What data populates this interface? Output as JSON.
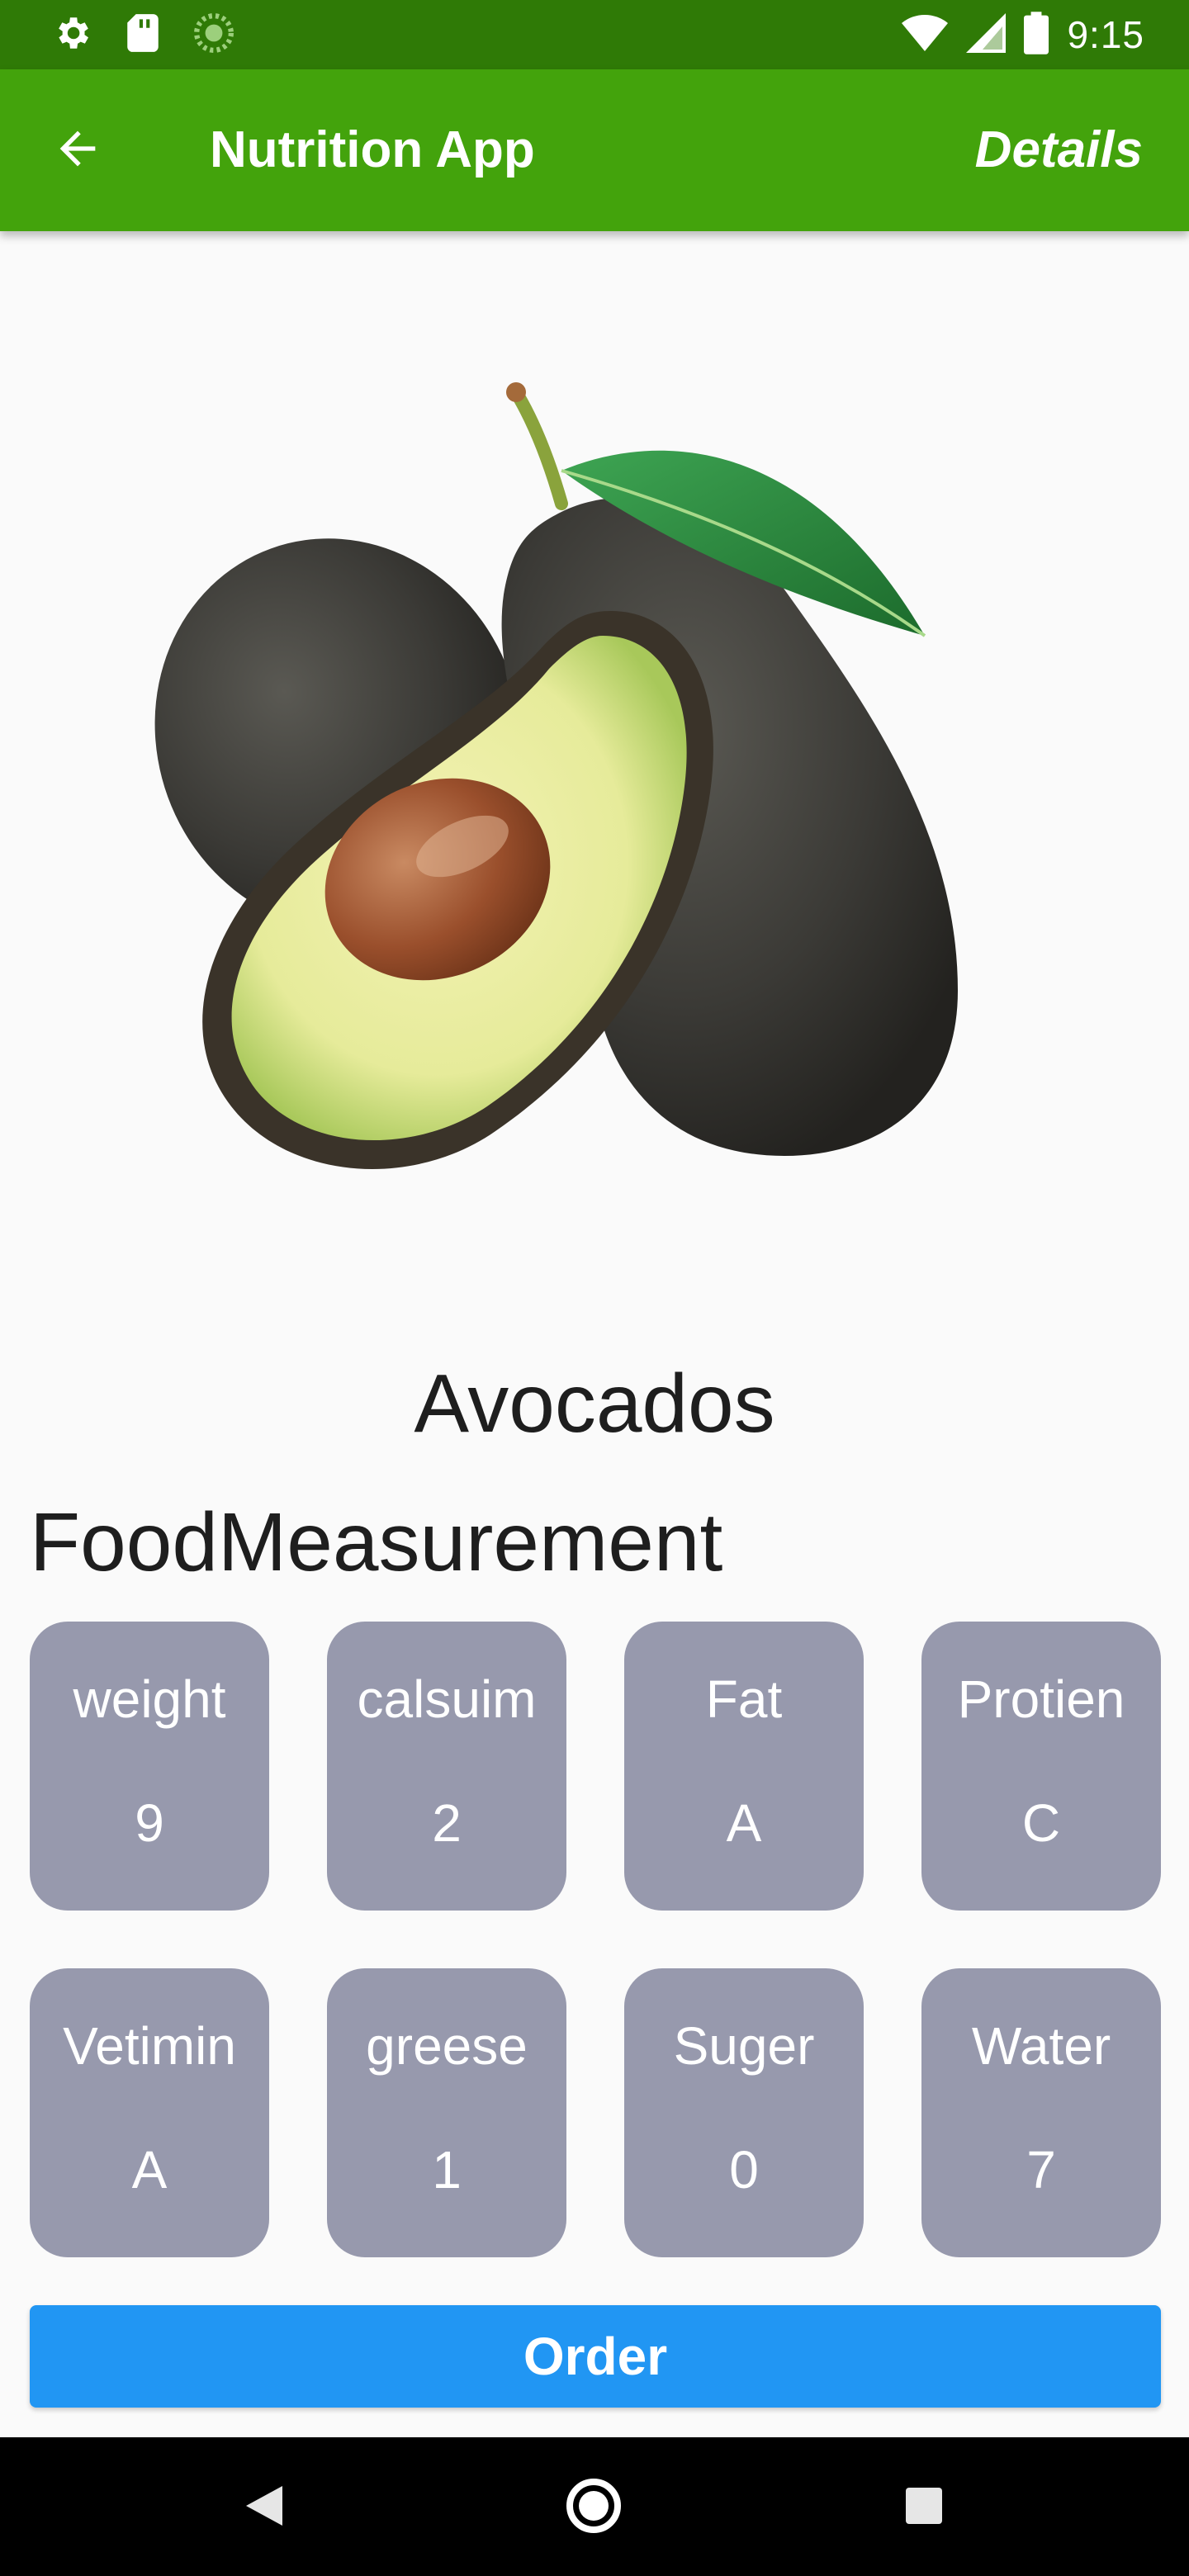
{
  "status_bar": {
    "time": "9:15",
    "icons": [
      "gear-icon",
      "sd-card-icon",
      "loading-icon",
      "wifi-icon",
      "signal-icon",
      "battery-icon"
    ]
  },
  "app_bar": {
    "title": "Nutrition App",
    "action_label": "Details",
    "back_icon": "arrow-left-icon"
  },
  "food": {
    "name": "Avocados",
    "image": "avocado-image"
  },
  "measurement": {
    "heading": "FoodMeasurement",
    "items": [
      {
        "label": "weight",
        "value": "9"
      },
      {
        "label": "calsuim",
        "value": "2"
      },
      {
        "label": "Fat",
        "value": "A"
      },
      {
        "label": "Protien",
        "value": "C"
      },
      {
        "label": "Vetimin",
        "value": "A"
      },
      {
        "label": "greese",
        "value": "1"
      },
      {
        "label": "Suger",
        "value": "0"
      },
      {
        "label": "Water",
        "value": "7"
      }
    ]
  },
  "order_button": {
    "label": "Order"
  },
  "nav_bar": {
    "icons": [
      "back-triangle-icon",
      "home-circle-icon",
      "recents-square-icon"
    ]
  },
  "colors": {
    "status_bar": "#2f7a06",
    "app_bar": "#43a30c",
    "tile": "#9799ad",
    "order_button": "#2196f3",
    "background": "#fafafa"
  }
}
